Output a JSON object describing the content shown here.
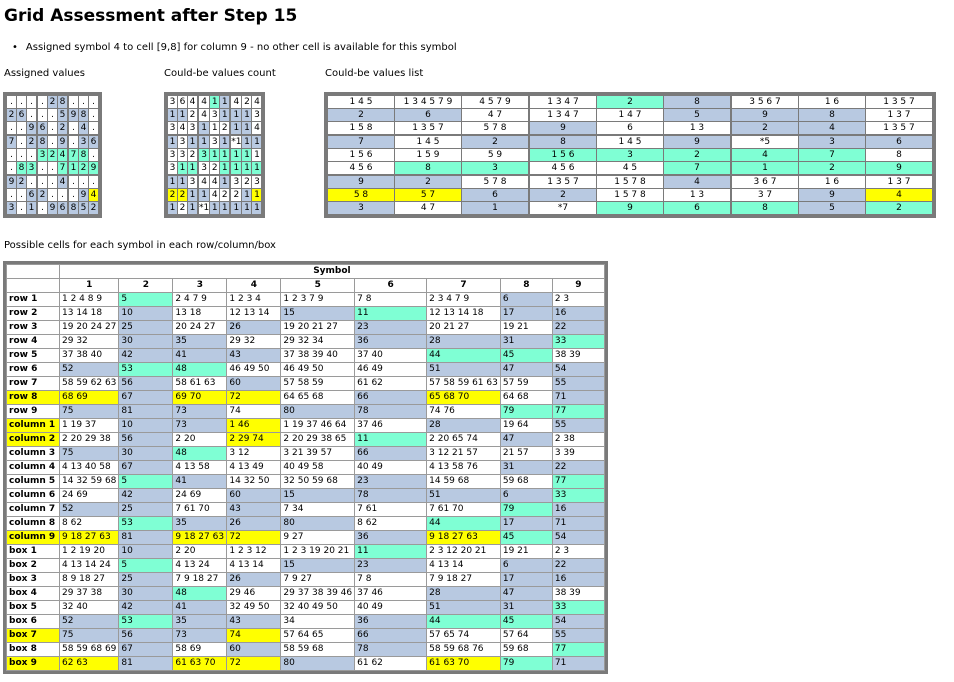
{
  "title": "Grid Assessment after Step 15",
  "note": "Assigned symbol 4 to cell [9,8] for column 9 - no other cell is available for this symbol",
  "captions": {
    "assigned": "Assigned values",
    "count": "Could-be values count",
    "list": "Could-be values list",
    "possible": "Possible cells for each symbol in each row/column/box"
  },
  "assigned_grid": [
    [
      ".",
      ".",
      ".",
      ".",
      "2",
      "8",
      ".",
      ".",
      "."
    ],
    [
      "2",
      "6",
      ".",
      ".",
      ".",
      "5",
      "9",
      "8",
      "."
    ],
    [
      ".",
      ".",
      "9",
      "6",
      ".",
      "2",
      ".",
      "4",
      "."
    ],
    [
      "7",
      ".",
      "2",
      "8",
      ".",
      "9",
      ".",
      "3",
      "6"
    ],
    [
      ".",
      ".",
      ".",
      "3",
      "2",
      "4",
      "7",
      "8",
      "."
    ],
    [
      ".",
      "8",
      "3",
      ".",
      ".",
      "7",
      "1",
      "2",
      "9"
    ],
    [
      "9",
      "2",
      ".",
      ".",
      ".",
      "4",
      ".",
      ".",
      "."
    ],
    [
      ".",
      ".",
      "6",
      "2",
      ".",
      ".",
      ".",
      "9",
      "4"
    ],
    [
      "3",
      ".",
      "1",
      ".",
      "9",
      "6",
      "8",
      "5",
      "2"
    ]
  ],
  "assigned_colors": [
    [
      "",
      "",
      "",
      "",
      "b",
      "b",
      "",
      "",
      ""
    ],
    [
      "b",
      "b",
      "",
      "",
      "",
      "b",
      "b",
      "b",
      ""
    ],
    [
      "",
      "",
      "b",
      "b",
      "",
      "b",
      "",
      "b",
      ""
    ],
    [
      "b",
      "",
      "b",
      "b",
      "",
      "b",
      "",
      "b",
      "b"
    ],
    [
      "",
      "",
      "",
      "g",
      "g",
      "g",
      "g",
      "g",
      ""
    ],
    [
      "",
      "g",
      "g",
      "",
      "",
      "g",
      "g",
      "g",
      "g"
    ],
    [
      "b",
      "b",
      "",
      "",
      "",
      "b",
      "",
      "",
      ""
    ],
    [
      "",
      "",
      "b",
      "b",
      "",
      "",
      "",
      "b",
      "y"
    ],
    [
      "b",
      "",
      "b",
      "",
      "b",
      "b",
      "b",
      "b",
      "b"
    ]
  ],
  "count_grid": [
    [
      "3",
      "6",
      "4",
      "4",
      "1",
      "1",
      "4",
      "2",
      "4"
    ],
    [
      "1",
      "1",
      "2",
      "4",
      "3",
      "1",
      "1",
      "1",
      "3"
    ],
    [
      "3",
      "4",
      "3",
      "1",
      "1",
      "2",
      "1",
      "1",
      "4"
    ],
    [
      "1",
      "3",
      "1",
      "1",
      "3",
      "1",
      "*1",
      "1",
      "1"
    ],
    [
      "3",
      "3",
      "2",
      "3",
      "1",
      "1",
      "1",
      "1",
      "1"
    ],
    [
      "3",
      "1",
      "1",
      "3",
      "2",
      "1",
      "1",
      "1",
      "1"
    ],
    [
      "1",
      "1",
      "3",
      "4",
      "4",
      "1",
      "3",
      "2",
      "3"
    ],
    [
      "2",
      "2",
      "1",
      "1",
      "4",
      "2",
      "2",
      "1",
      "1"
    ],
    [
      "1",
      "2",
      "1",
      "*1",
      "1",
      "1",
      "1",
      "1",
      "1"
    ]
  ],
  "count_colors": [
    [
      "",
      "",
      "",
      "",
      "g",
      "b",
      "",
      "",
      ""
    ],
    [
      "b",
      "b",
      "",
      "",
      "",
      "b",
      "b",
      "b",
      ""
    ],
    [
      "",
      "",
      "",
      "b",
      "",
      "",
      "b",
      "b",
      ""
    ],
    [
      "b",
      "",
      "b",
      "b",
      "",
      "b",
      "",
      "b",
      "b"
    ],
    [
      "",
      "",
      "",
      "g",
      "g",
      "g",
      "g",
      "g",
      ""
    ],
    [
      "",
      "g",
      "g",
      "",
      "",
      "g",
      "g",
      "g",
      "g"
    ],
    [
      "b",
      "b",
      "",
      "",
      "",
      "b",
      "",
      "",
      ""
    ],
    [
      "y",
      "y",
      "b",
      "b",
      "",
      "",
      "",
      "b",
      "y"
    ],
    [
      "b",
      "",
      "b",
      "",
      "b",
      "b",
      "b",
      "b",
      "b"
    ]
  ],
  "list_grid": [
    [
      "1 4 5",
      "1 3 4 5 7 9",
      "4 5 7 9",
      "1 3 4 7",
      "2",
      "8",
      "3 5 6 7",
      "1 6",
      "1 3 5 7"
    ],
    [
      "2",
      "6",
      "4 7",
      "1 3 4 7",
      "1 4 7",
      "5",
      "9",
      "8",
      "1 3 7"
    ],
    [
      "1 5 8",
      "1 3 5 7",
      "5 7 8",
      "9",
      "6",
      "1 3",
      "2",
      "4",
      "1 3 5 7"
    ],
    [
      "7",
      "1 4 5",
      "2",
      "8",
      "1 4 5",
      "9",
      "*5",
      "3",
      "6"
    ],
    [
      "1 5 6",
      "1 5 9",
      "5 9",
      "1 5 6",
      "3",
      "2",
      "4",
      "7",
      "8"
    ],
    [
      "4 5 6",
      "8",
      "3",
      "4 5 6",
      "4 5",
      "7",
      "1",
      "2",
      "9"
    ],
    [
      "9",
      "2",
      "5 7 8",
      "1 3 5 7",
      "1 5 7 8",
      "4",
      "3 6 7",
      "1 6",
      "1 3 7"
    ],
    [
      "5 8",
      "5 7",
      "6",
      "2",
      "1 5 7 8",
      "1 3",
      "3 7",
      "9",
      "4"
    ],
    [
      "3",
      "4 7",
      "1",
      "*7",
      "9",
      "6",
      "8",
      "5",
      "2"
    ]
  ],
  "list_colors": [
    [
      "",
      "",
      "",
      "",
      "g",
      "b",
      "",
      "",
      ""
    ],
    [
      "b",
      "b",
      "",
      "",
      "",
      "b",
      "b",
      "b",
      ""
    ],
    [
      "",
      "",
      "",
      "b",
      "",
      "",
      "b",
      "b",
      ""
    ],
    [
      "b",
      "",
      "b",
      "b",
      "",
      "b",
      "",
      "b",
      "b"
    ],
    [
      "",
      "",
      "",
      "g",
      "g",
      "g",
      "g",
      "g",
      ""
    ],
    [
      "",
      "g",
      "g",
      "",
      "",
      "g",
      "g",
      "g",
      "g"
    ],
    [
      "b",
      "b",
      "",
      "",
      "",
      "b",
      "",
      "",
      ""
    ],
    [
      "y",
      "y",
      "b",
      "b",
      "",
      "",
      "",
      "b",
      "y"
    ],
    [
      "b",
      "",
      "b",
      "",
      "g",
      "g",
      "g",
      "b",
      "g"
    ]
  ],
  "symbol_header": "Symbol",
  "symbols": [
    "1",
    "2",
    "3",
    "4",
    "5",
    "6",
    "7",
    "8",
    "9"
  ],
  "rows": [
    {
      "label": "row 1",
      "cells": [
        "1 2 4 8 9",
        "5",
        "2 4 7 9",
        "1 2 3 4",
        "1 2 3 7 9",
        "7 8",
        "2 3 4 7 9",
        "6",
        "2 3"
      ],
      "colors": [
        "",
        "g",
        "",
        "",
        "",
        "",
        "",
        "b",
        ""
      ]
    },
    {
      "label": "row 2",
      "cells": [
        "13 14 18",
        "10",
        "13 18",
        "12 13 14",
        "15",
        "11",
        "12 13 14 18",
        "17",
        "16"
      ],
      "colors": [
        "",
        "b",
        "",
        "",
        "b",
        "g",
        "",
        "b",
        "b"
      ]
    },
    {
      "label": "row 3",
      "cells": [
        "19 20 24 27",
        "25",
        "20 24 27",
        "26",
        "19 20 21 27",
        "23",
        "20 21 27",
        "19 21",
        "22"
      ],
      "colors": [
        "",
        "b",
        "",
        "b",
        "",
        "b",
        "",
        "",
        "b"
      ]
    },
    {
      "label": "row 4",
      "cells": [
        "29 32",
        "30",
        "35",
        "29 32",
        "29 32 34",
        "36",
        "28",
        "31",
        "33"
      ],
      "colors": [
        "",
        "b",
        "b",
        "",
        "",
        "b",
        "b",
        "b",
        "g"
      ]
    },
    {
      "label": "row 5",
      "cells": [
        "37 38 40",
        "42",
        "41",
        "43",
        "37 38 39 40",
        "37 40",
        "44",
        "45",
        "38 39"
      ],
      "colors": [
        "",
        "b",
        "b",
        "b",
        "",
        "",
        "g",
        "g",
        ""
      ]
    },
    {
      "label": "row 6",
      "cells": [
        "52",
        "53",
        "48",
        "46 49 50",
        "46 49 50",
        "46 49",
        "51",
        "47",
        "54"
      ],
      "colors": [
        "b",
        "g",
        "g",
        "",
        "",
        "",
        "b",
        "b",
        "b"
      ]
    },
    {
      "label": "row 7",
      "cells": [
        "58 59 62 63",
        "56",
        "58 61 63",
        "60",
        "57 58 59",
        "61 62",
        "57 58 59 61 63",
        "57 59",
        "55"
      ],
      "colors": [
        "",
        "b",
        "",
        "b",
        "",
        "",
        "",
        "",
        "b"
      ]
    },
    {
      "label": "row 8",
      "cells": [
        "68 69",
        "67",
        "69 70",
        "72",
        "64 65 68",
        "66",
        "65 68 70",
        "64 68",
        "71"
      ],
      "colors": [
        "y",
        "b",
        "y",
        "y",
        "",
        "b",
        "y",
        "",
        "b"
      ]
    },
    {
      "label": "row 9",
      "cells": [
        "75",
        "81",
        "73",
        "74",
        "80",
        "78",
        "74 76",
        "79",
        "77"
      ],
      "colors": [
        "b",
        "b",
        "b",
        "",
        "b",
        "b",
        "",
        "g",
        "g"
      ]
    },
    {
      "label": "column 1",
      "cells": [
        "1 19 37",
        "10",
        "73",
        "1 46",
        "1 19 37 46 64",
        "37 46",
        "28",
        "19 64",
        "55"
      ],
      "colors": [
        "",
        "b",
        "b",
        "y",
        "",
        "",
        "b",
        "",
        "b"
      ]
    },
    {
      "label": "column 2",
      "cells": [
        "2 20 29 38",
        "56",
        "2 20",
        "2 29 74",
        "2 20 29 38 65",
        "11",
        "2 20 65 74",
        "47",
        "2 38"
      ],
      "colors": [
        "",
        "b",
        "",
        "y",
        "",
        "g",
        "",
        "b",
        ""
      ]
    },
    {
      "label": "column 3",
      "cells": [
        "75",
        "30",
        "48",
        "3 12",
        "3 21 39 57",
        "66",
        "3 12 21 57",
        "21 57",
        "3 39"
      ],
      "colors": [
        "b",
        "b",
        "g",
        "",
        "",
        "b",
        "",
        "",
        ""
      ]
    },
    {
      "label": "column 4",
      "cells": [
        "4 13 40 58",
        "67",
        "4 13 58",
        "4 13 49",
        "40 49 58",
        "40 49",
        "4 13 58 76",
        "31",
        "22"
      ],
      "colors": [
        "",
        "b",
        "",
        "",
        "",
        "",
        "",
        "b",
        "b"
      ]
    },
    {
      "label": "column 5",
      "cells": [
        "14 32 59 68",
        "5",
        "41",
        "14 32 50",
        "32 50 59 68",
        "23",
        "14 59 68",
        "59 68",
        "77"
      ],
      "colors": [
        "",
        "g",
        "b",
        "",
        "",
        "b",
        "",
        "",
        "g"
      ]
    },
    {
      "label": "column 6",
      "cells": [
        "24 69",
        "42",
        "24 69",
        "60",
        "15",
        "78",
        "51",
        "6",
        "33"
      ],
      "colors": [
        "",
        "b",
        "",
        "b",
        "b",
        "b",
        "b",
        "b",
        "g"
      ]
    },
    {
      "label": "column 7",
      "cells": [
        "52",
        "25",
        "7 61 70",
        "43",
        "7 34",
        "7 61",
        "7 61 70",
        "79",
        "16"
      ],
      "colors": [
        "b",
        "b",
        "",
        "b",
        "",
        "",
        "",
        "g",
        "b"
      ]
    },
    {
      "label": "column 8",
      "cells": [
        "8 62",
        "53",
        "35",
        "26",
        "80",
        "8 62",
        "44",
        "17",
        "71"
      ],
      "colors": [
        "",
        "g",
        "b",
        "b",
        "b",
        "",
        "g",
        "b",
        "b"
      ]
    },
    {
      "label": "column 9",
      "cells": [
        "9 18 27 63",
        "81",
        "9 18 27 63",
        "72",
        "9 27",
        "36",
        "9 18 27 63",
        "45",
        "54"
      ],
      "colors": [
        "y",
        "b",
        "y",
        "y",
        "",
        "b",
        "y",
        "g",
        "b"
      ]
    },
    {
      "label": "box 1",
      "cells": [
        "1 2 19 20",
        "10",
        "2 20",
        "1 2 3 12",
        "1 2 3 19 20 21",
        "11",
        "2 3 12 20 21",
        "19 21",
        "2 3"
      ],
      "colors": [
        "",
        "b",
        "",
        "",
        "",
        "g",
        "",
        "",
        ""
      ]
    },
    {
      "label": "box 2",
      "cells": [
        "4 13 14 24",
        "5",
        "4 13 24",
        "4 13 14",
        "15",
        "23",
        "4 13 14",
        "6",
        "22"
      ],
      "colors": [
        "",
        "g",
        "",
        "",
        "b",
        "b",
        "",
        "b",
        "b"
      ]
    },
    {
      "label": "box 3",
      "cells": [
        "8 9 18 27",
        "25",
        "7 9 18 27",
        "26",
        "7 9 27",
        "7 8",
        "7 9 18 27",
        "17",
        "16"
      ],
      "colors": [
        "",
        "b",
        "",
        "b",
        "",
        "",
        "",
        "b",
        "b"
      ]
    },
    {
      "label": "box 4",
      "cells": [
        "29 37 38",
        "30",
        "48",
        "29 46",
        "29 37 38 39 46",
        "37 46",
        "28",
        "47",
        "38 39"
      ],
      "colors": [
        "",
        "b",
        "g",
        "",
        "",
        "",
        "b",
        "b",
        ""
      ]
    },
    {
      "label": "box 5",
      "cells": [
        "32 40",
        "42",
        "41",
        "32 49 50",
        "32 40 49 50",
        "40 49",
        "51",
        "31",
        "33"
      ],
      "colors": [
        "",
        "b",
        "b",
        "",
        "",
        "",
        "b",
        "b",
        "g"
      ]
    },
    {
      "label": "box 6",
      "cells": [
        "52",
        "53",
        "35",
        "43",
        "34",
        "36",
        "44",
        "45",
        "54"
      ],
      "colors": [
        "b",
        "g",
        "b",
        "b",
        "",
        "b",
        "g",
        "g",
        "b"
      ]
    },
    {
      "label": "box 7",
      "cells": [
        "75",
        "56",
        "73",
        "74",
        "57 64 65",
        "66",
        "57 65 74",
        "57 64",
        "55"
      ],
      "colors": [
        "b",
        "b",
        "b",
        "y",
        "",
        "b",
        "",
        "",
        "b"
      ]
    },
    {
      "label": "box 8",
      "cells": [
        "58 59 68 69",
        "67",
        "58 69",
        "60",
        "58 59 68",
        "78",
        "58 59 68 76",
        "59 68",
        "77"
      ],
      "colors": [
        "",
        "b",
        "",
        "b",
        "",
        "b",
        "",
        "",
        "g"
      ]
    },
    {
      "label": "box 9",
      "cells": [
        "62 63",
        "81",
        "61 63 70",
        "72",
        "80",
        "61 62",
        "61 63 70",
        "79",
        "71"
      ],
      "colors": [
        "y",
        "b",
        "y",
        "y",
        "b",
        "",
        "y",
        "g",
        "b"
      ]
    }
  ],
  "row_label_colors": {
    "row 8": "y",
    "column 1": "y",
    "column 2": "y",
    "column 9": "y",
    "box 7": "y",
    "box 9": "y"
  },
  "colors": {
    "blue": "#b8c9e1",
    "green": "#7fffd4",
    "yellow": "#ffff00",
    "frame": "#7a7a7a"
  }
}
